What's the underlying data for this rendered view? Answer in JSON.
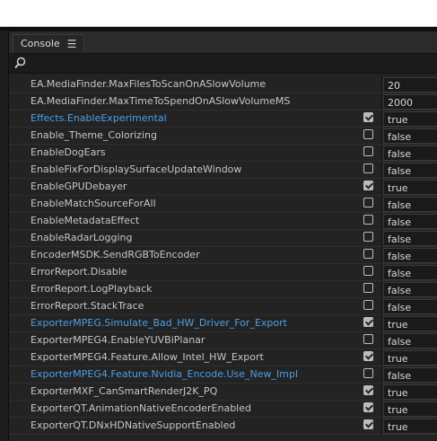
{
  "panel": {
    "tab_label": "Console",
    "menu_icon": "hamburger-menu-icon",
    "search_icon": "search-icon",
    "search_value": ""
  },
  "colors": {
    "modified_text": "#4b9fe6",
    "default_text": "#c6c6c6",
    "panel_bg": "#232323"
  },
  "rows": [
    {
      "name": "EA.MediaFinder.MaxFilesToScanOnASlowVolume",
      "checkbox": null,
      "value": "20",
      "modified": false
    },
    {
      "name": "EA.MediaFinder.MaxTimeToSpendOnASlowVolumeMS",
      "checkbox": null,
      "value": "2000",
      "modified": false
    },
    {
      "name": "Effects.EnableExperimental",
      "checkbox": true,
      "value": "true",
      "modified": true
    },
    {
      "name": "Enable_Theme_Colorizing",
      "checkbox": false,
      "value": "false",
      "modified": false
    },
    {
      "name": "EnableDogEars",
      "checkbox": false,
      "value": "false",
      "modified": false
    },
    {
      "name": "EnableFixForDisplaySurfaceUpdateWindow",
      "checkbox": false,
      "value": "false",
      "modified": false
    },
    {
      "name": "EnableGPUDebayer",
      "checkbox": true,
      "value": "true",
      "modified": false
    },
    {
      "name": "EnableMatchSourceForAll",
      "checkbox": false,
      "value": "false",
      "modified": false
    },
    {
      "name": "EnableMetadataEffect",
      "checkbox": false,
      "value": "false",
      "modified": false
    },
    {
      "name": "EnableRadarLogging",
      "checkbox": false,
      "value": "false",
      "modified": false
    },
    {
      "name": "EncoderMSDK.SendRGBToEncoder",
      "checkbox": false,
      "value": "false",
      "modified": false
    },
    {
      "name": "ErrorReport.Disable",
      "checkbox": false,
      "value": "false",
      "modified": false
    },
    {
      "name": "ErrorReport.LogPlayback",
      "checkbox": false,
      "value": "false",
      "modified": false
    },
    {
      "name": "ErrorReport.StackTrace",
      "checkbox": false,
      "value": "false",
      "modified": false
    },
    {
      "name": "ExporterMPEG.Simulate_Bad_HW_Driver_For_Export",
      "checkbox": true,
      "value": "true",
      "modified": true
    },
    {
      "name": "ExporterMPEG4.EnableYUVBiPlanar",
      "checkbox": false,
      "value": "false",
      "modified": false
    },
    {
      "name": "ExporterMPEG4.Feature.Allow_Intel_HW_Export",
      "checkbox": true,
      "value": "true",
      "modified": false
    },
    {
      "name": "ExporterMPEG4.Feature.Nvidia_Encode.Use_New_Impl",
      "checkbox": false,
      "value": "false",
      "modified": true
    },
    {
      "name": "ExporterMXF_CanSmartRenderJ2K_PQ",
      "checkbox": true,
      "value": "true",
      "modified": false
    },
    {
      "name": "ExporterQT.AnimationNativeEncoderEnabled",
      "checkbox": true,
      "value": "true",
      "modified": false
    },
    {
      "name": "ExporterQT.DNxHDNativeSupportEnabled",
      "checkbox": true,
      "value": "true",
      "modified": false
    }
  ]
}
